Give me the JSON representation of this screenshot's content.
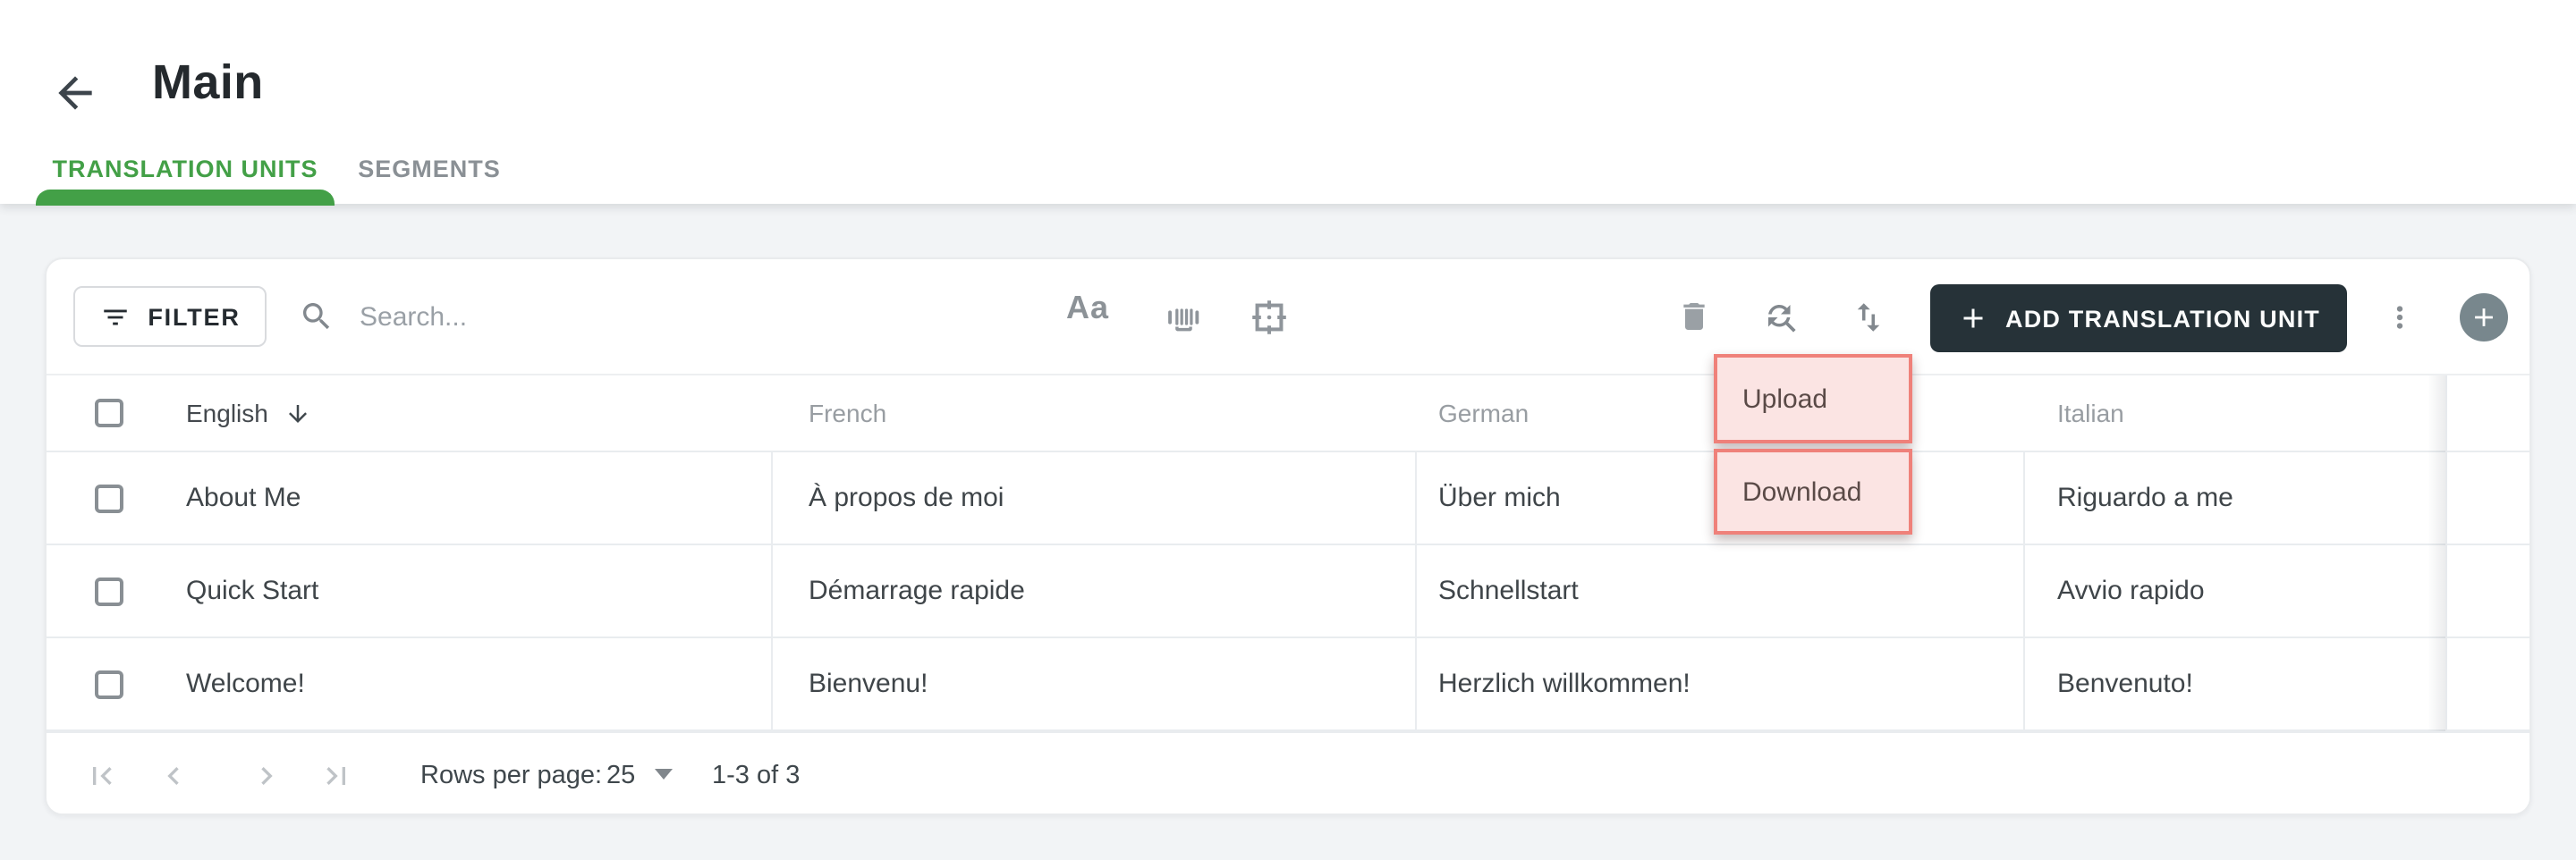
{
  "header": {
    "title": "Main"
  },
  "tabs": [
    {
      "label": "TRANSLATION UNITS",
      "active": true
    },
    {
      "label": "SEGMENTS",
      "active": false
    }
  ],
  "toolbar": {
    "filter_label": "FILTER",
    "search_placeholder": "Search...",
    "case_toggle_label": "Aa",
    "add_button_label": "ADD TRANSLATION UNIT",
    "icons": [
      "filter-icon",
      "search-icon",
      "case-toggle-icon",
      "barcode-icon",
      "frame-scan-icon",
      "delete-icon",
      "find-replace-icon",
      "sort-icon",
      "more-vert-icon",
      "add-circle-icon"
    ]
  },
  "menu": {
    "items": [
      {
        "label": "Upload"
      },
      {
        "label": "Download"
      }
    ],
    "highlight_border_color": "#EF817A",
    "highlight_fill_color": "#FBE4E3"
  },
  "table": {
    "header": {
      "english": "English",
      "french": "French",
      "german": "German",
      "italian": "Italian"
    },
    "sorted_column": "English",
    "sort_direction": "descending",
    "rows": [
      {
        "english": "About Me",
        "french": "À propos de moi",
        "german": "Über mich",
        "italian": "Riguardo a me"
      },
      {
        "english": "Quick Start",
        "french": "Démarrage rapide",
        "german": "Schnellstart",
        "italian": "Avvio rapido"
      },
      {
        "english": "Welcome!",
        "french": "Bienvenu!",
        "german": "Herzlich willkommen!",
        "italian": "Benvenuto!"
      }
    ]
  },
  "pagination": {
    "rows_per_page_label": "Rows per page:",
    "rows_per_page_value": "25",
    "range_label": "1-3 of 3"
  },
  "colors": {
    "accent_green": "#43A047",
    "dark_button": "#263238",
    "page_background": "#F2F4F6",
    "fab_grey": "#78878D"
  }
}
